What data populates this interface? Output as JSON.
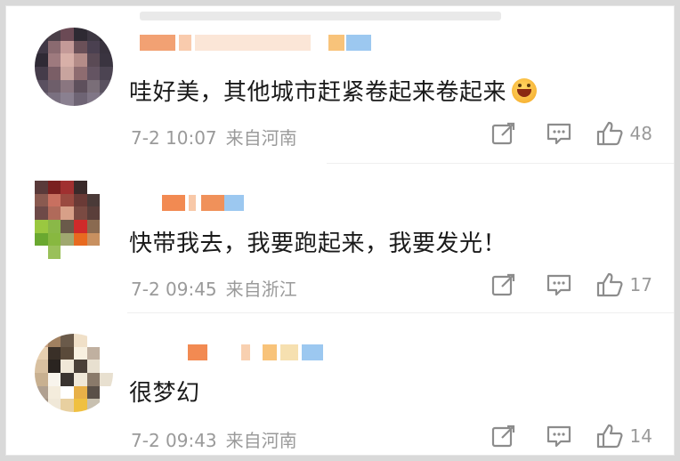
{
  "comments": [
    {
      "text": "哇好美，其他城市赶紧卷起来卷起来",
      "has_emoji": true,
      "emoji": "laughing-face",
      "time": "7-2 10:07",
      "location": "来自河南",
      "likes": "48"
    },
    {
      "text": "快带我去，我要跑起来，我要发光！",
      "has_emoji": false,
      "time": "7-2 09:45",
      "location": "来自浙江",
      "likes": "17"
    },
    {
      "text": "很梦幻",
      "has_emoji": false,
      "time": "7-2 09:43",
      "location": "来自河南",
      "likes": "14"
    }
  ],
  "icons": {
    "share": "share-icon",
    "reply": "comment-icon",
    "like": "thumbs-up-icon"
  },
  "colors": {
    "text": "#1a1a1a",
    "meta": "#9a9a9a",
    "icon": "#8c8c8c",
    "username_orange": "#f0915a",
    "username_blue": "#9cc8f0"
  }
}
